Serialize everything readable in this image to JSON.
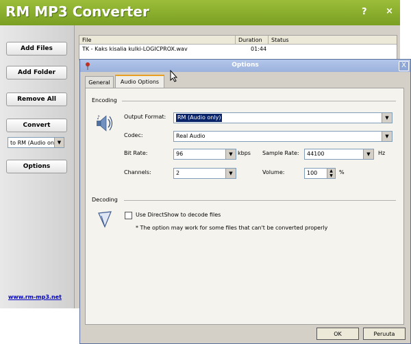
{
  "app": {
    "title": "RM MP3 Converter",
    "help": "?",
    "close": "×"
  },
  "sidebar": {
    "add_files": "Add Files",
    "add_folder": "Add Folder",
    "remove_all": "Remove All",
    "convert": "Convert",
    "format_select": "to RM (Audio only)",
    "options": "Options",
    "site_link": "www.rm-mp3.net"
  },
  "file_list": {
    "columns": [
      "File",
      "Duration",
      "Status"
    ],
    "rows": [
      {
        "file": "TK - Kaks kisalia kulki-LOGICPROX.wav",
        "duration": "01:44",
        "status": ""
      }
    ]
  },
  "dialog": {
    "title": "Options",
    "close": "X",
    "tabs": [
      "General",
      "Audio Options"
    ],
    "active_tab": "Audio Options",
    "encoding": {
      "section": "Encoding",
      "output_format_label": "Output Format:",
      "output_format": "RM (Audio only)",
      "codec_label": "Codec:",
      "codec": "Real Audio",
      "bitrate_label": "Bit Rate:",
      "bitrate": "96",
      "bitrate_unit": "kbps",
      "sample_rate_label": "Sample Rate:",
      "sample_rate": "44100",
      "sample_rate_unit": "Hz",
      "channels_label": "Channels:",
      "channels": "2",
      "volume_label": "Volume:",
      "volume": "100",
      "volume_unit": "%"
    },
    "decoding": {
      "section": "Decoding",
      "directshow_label": "Use DirectShow to decode files",
      "directshow_checked": false,
      "note": "* The option may work for some files that can't be converted properly"
    },
    "ok": "OK",
    "cancel": "Peruuta"
  },
  "colors": {
    "title_bar": "#8cb02e",
    "dialog_title": "#a8bde6",
    "selection": "#0a246a",
    "link": "#0000c0"
  }
}
